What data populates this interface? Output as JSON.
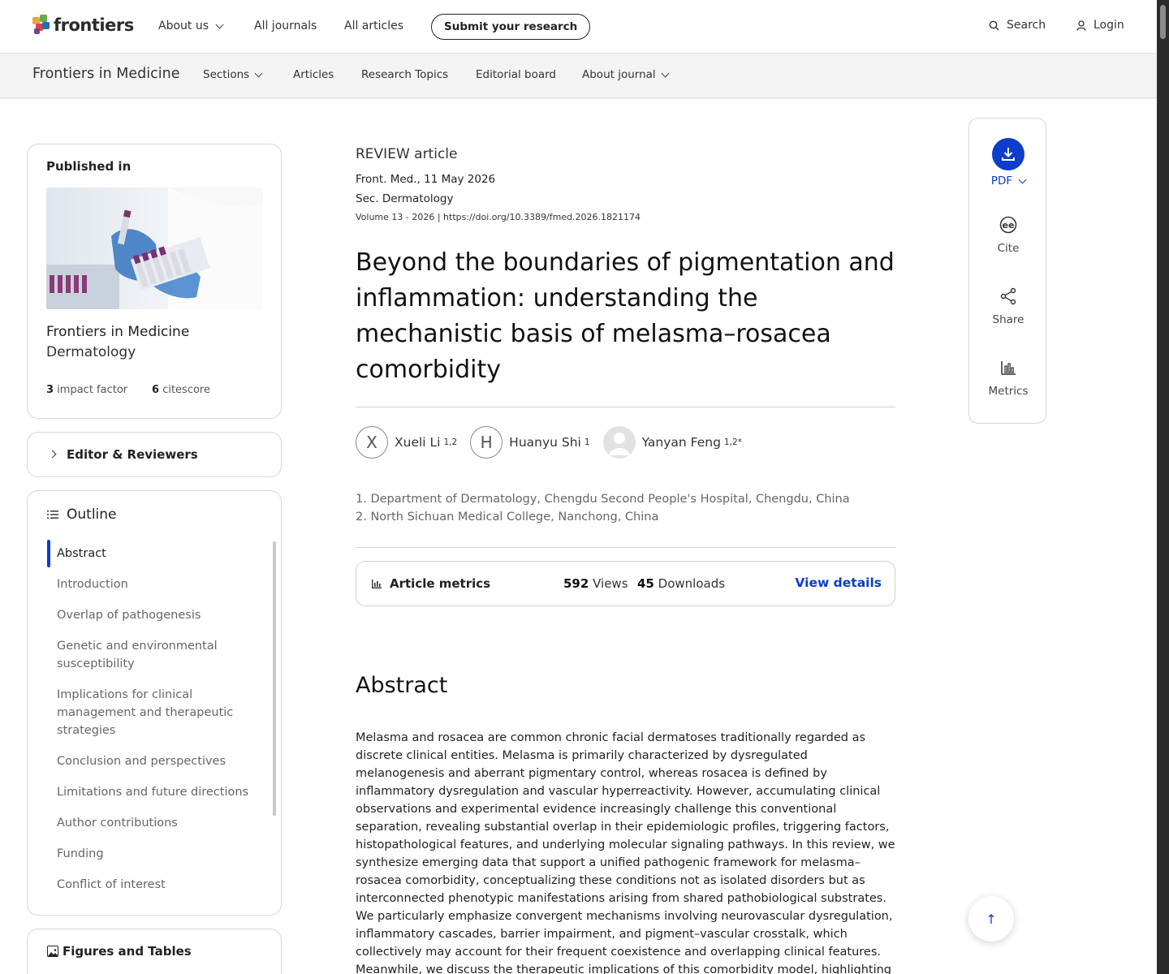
{
  "colors": {
    "accent": "#0c3dcc",
    "logo_green": "#64a84a",
    "logo_orange": "#f2a33a",
    "logo_red": "#d8453c",
    "logo_blue": "#2a6bb4"
  },
  "topnav": {
    "logo_text": "frontiers",
    "about_us": "About us",
    "all_journals": "All journals",
    "all_articles": "All articles",
    "submit": "Submit your research",
    "search": "Search",
    "login": "Login"
  },
  "journalnav": {
    "title": "Frontiers in Medicine",
    "sections": "Sections",
    "articles": "Articles",
    "research_topics": "Research Topics",
    "editorial_board": "Editorial board",
    "about_journal": "About journal"
  },
  "published_in": {
    "heading": "Published in",
    "journal": "Frontiers in Medicine",
    "section": "Dermatology",
    "impact_factor_value": "3",
    "impact_factor_label": "impact factor",
    "citescore_value": "6",
    "citescore_label": "citescore"
  },
  "editor_reviewers": "Editor & Reviewers",
  "outline": {
    "heading": "Outline",
    "items": [
      "Abstract",
      "Introduction",
      "Overlap of pathogenesis",
      "Genetic and environmental susceptibility",
      "Implications for clinical management and therapeutic strategies",
      "Conclusion and perspectives",
      "Limitations and future directions",
      "Author contributions",
      "Funding",
      "Conflict of interest"
    ]
  },
  "figures_tables": "Figures and Tables",
  "article": {
    "type": "REVIEW article",
    "journal_date": "Front. Med., 11 May 2026",
    "section": "Sec. Dermatology",
    "volume_doi": "Volume 13 - 2026 | https://doi.org/10.3389/fmed.2026.1821174",
    "title": "Beyond the boundaries of pigmentation and inflammation: understanding the mechanistic basis of melasma–rosacea comorbidity",
    "authors": [
      {
        "initial": "X",
        "name": "Xueli Li",
        "sup": "1,2"
      },
      {
        "initial": "H",
        "name": "Huanyu Shi",
        "sup": "1"
      },
      {
        "initial": "",
        "name": "Yanyan Feng",
        "sup": "1,2*"
      }
    ],
    "affiliations": [
      "1. Department of Dermatology, Chengdu Second People's Hospital, Chengdu, China",
      "2. North Sichuan Medical College, Nanchong, China"
    ],
    "metrics": {
      "label": "Article metrics",
      "views_value": "592",
      "views_label": "Views",
      "downloads_value": "45",
      "downloads_label": "Downloads",
      "view_details": "View details"
    },
    "abstract_heading": "Abstract",
    "abstract_text": "Melasma and rosacea are common chronic facial dermatoses traditionally regarded as discrete clinical entities. Melasma is primarily characterized by dysregulated melanogenesis and aberrant pigmentary control, whereas rosacea is defined by inflammatory dysregulation and vascular hyperreactivity. However, accumulating clinical observations and experimental evidence increasingly challenge this conventional separation, revealing substantial overlap in their epidemiologic profiles, triggering factors, histopathological features, and underlying molecular signaling pathways. In this review, we synthesize emerging data that support a unified pathogenic framework for melasma–rosacea comorbidity, conceptualizing these conditions not as isolated disorders but as interconnected phenotypic manifestations arising from shared pathobiological substrates. We particularly emphasize convergent mechanisms involving neurovascular dysregulation, inflammatory cascades, barrier impairment, and pigment–vascular crosstalk, which collectively may account for their frequent coexistence and overlapping clinical features. Meanwhile, we discuss the therapeutic implications of this comorbidity model, highlighting"
  },
  "rail": {
    "pdf": "PDF",
    "cite": "Cite",
    "share": "Share",
    "metrics": "Metrics"
  }
}
